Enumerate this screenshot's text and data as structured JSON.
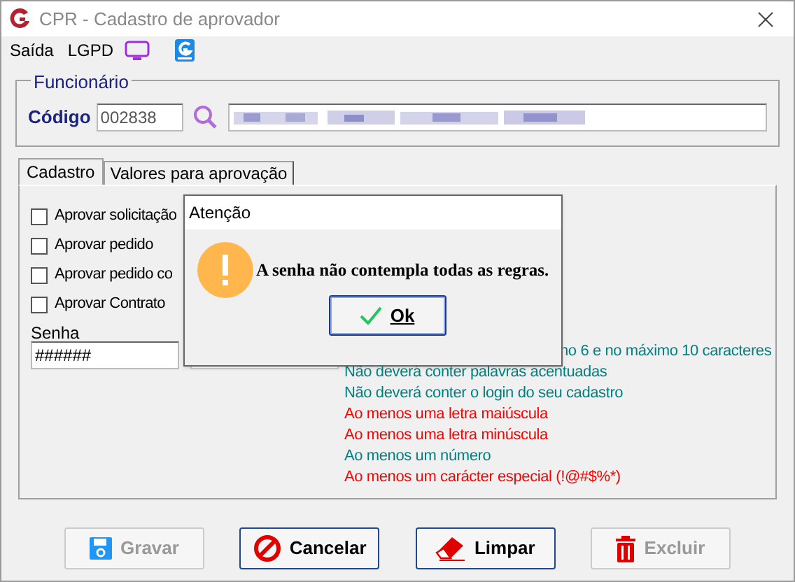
{
  "window": {
    "title": "CPR - Cadastro de aprovador"
  },
  "menu": [
    "Saída",
    "LGPD"
  ],
  "employee_group": {
    "title": "Funcionário",
    "code_label": "Código",
    "code": "002838"
  },
  "tabs": [
    {
      "label": "Cadastro",
      "selected": true
    },
    {
      "label": "Valores para aprovação",
      "selected": false
    }
  ],
  "checkboxes": [
    {
      "label": "Aprovar solicitação",
      "checked": false
    },
    {
      "label": "Aprovar pedido",
      "checked": false
    },
    {
      "label": "Aprovar pedido co",
      "checked": false
    },
    {
      "label": "Aprovar Contrato",
      "checked": false
    }
  ],
  "password": {
    "label": "Senha",
    "value": "######"
  },
  "rules": [
    {
      "text": "no 6 e no máximo 10 caracteres",
      "color": "#008080"
    },
    {
      "text": "Não deverá conter palavras acentuadas",
      "color": "#008080"
    },
    {
      "text": "Não deverá conter o login do seu cadastro",
      "color": "#008080"
    },
    {
      "text": "Ao menos uma letra maiúscula",
      "color": "#ff0000"
    },
    {
      "text": "Ao menos uma letra minúscula",
      "color": "#ff0000"
    },
    {
      "text": "Ao menos um número",
      "color": "#008080"
    },
    {
      "text": "Ao menos um carácter especial (!@#$%*)",
      "color": "#ff0000"
    }
  ],
  "buttons": [
    {
      "kind": "save",
      "label": "Gravar",
      "disabled": true
    },
    {
      "kind": "cancel",
      "label": "Cancelar",
      "disabled": false
    },
    {
      "kind": "clear",
      "label": "Limpar",
      "disabled": false
    },
    {
      "kind": "delete",
      "label": "Excluir",
      "disabled": true
    }
  ],
  "dialog": {
    "title": "Atenção",
    "message": "A senha não contempla todas as regras.",
    "button": "Ok"
  }
}
